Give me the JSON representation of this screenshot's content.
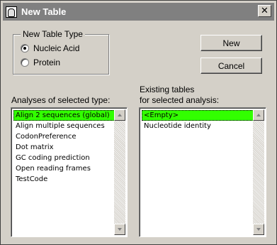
{
  "window": {
    "title": "New Table",
    "close_glyph": "✕"
  },
  "table_type": {
    "group_title": "New Table Type",
    "options": [
      {
        "label": "Nucleic Acid",
        "checked": true
      },
      {
        "label": "Protein",
        "checked": false
      }
    ]
  },
  "buttons": {
    "new_label": "New",
    "cancel_label": "Cancel"
  },
  "analyses": {
    "label": "Analyses of selected type:",
    "items": [
      "Align 2 sequences (global)",
      "Align multiple sequences",
      "CodonPreference",
      "Dot matrix",
      "GC coding prediction",
      "Open reading frames",
      "TestCode"
    ],
    "selected_index": 0
  },
  "existing": {
    "label_line1": "Existing tables",
    "label_line2": "for selected analysis:",
    "items": [
      "<Empty>",
      "Nucleotide identity"
    ],
    "selected_index": 0
  },
  "colors": {
    "selection": "#32ff00",
    "titlebar": "#808080",
    "face": "#d4d0c8"
  }
}
